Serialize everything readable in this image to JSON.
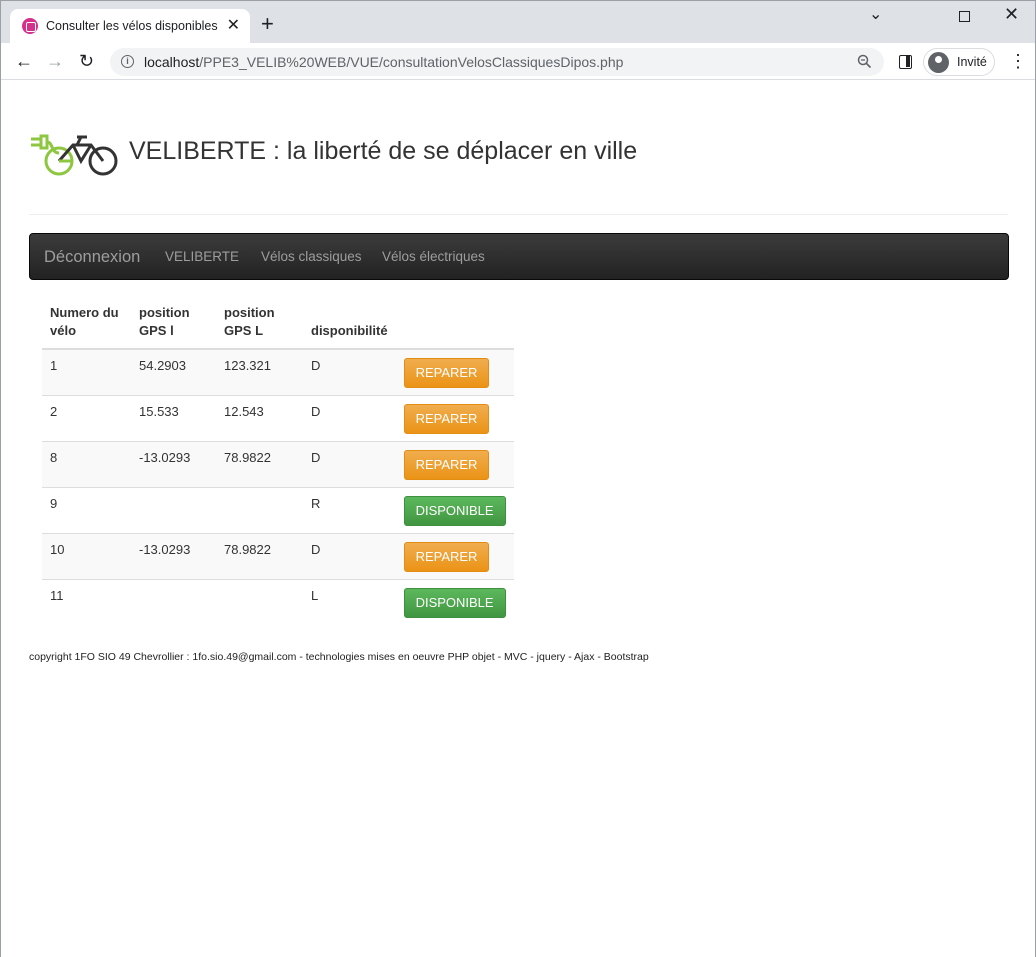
{
  "browser": {
    "tab_title": "Consulter les vélos disponibles...",
    "tab_close": "✕",
    "new_tab": "+",
    "url_host": "localhost",
    "url_path": "/PPE3_VELIB%20WEB/VUE/consultationVelosClassiquesDipos.php",
    "profile_label": "Invité"
  },
  "header": {
    "title": "VELIBERTE : la liberté de se déplacer en ville"
  },
  "navbar": {
    "brand": "Déconnexion",
    "links": [
      "VELIBERTE",
      "Vélos classiques",
      "Vélos électriques"
    ]
  },
  "table": {
    "headers": [
      "Numero du vélo",
      "position GPS l",
      "position GPS L",
      "disponibilité",
      ""
    ],
    "rows": [
      {
        "num": "1",
        "lat": "54.2903",
        "lng": "123.321",
        "dispo": "D",
        "action": "REPARER",
        "kind": "warning"
      },
      {
        "num": "2",
        "lat": "15.533",
        "lng": "12.543",
        "dispo": "D",
        "action": "REPARER",
        "kind": "warning"
      },
      {
        "num": "8",
        "lat": "-13.0293",
        "lng": "78.9822",
        "dispo": "D",
        "action": "REPARER",
        "kind": "warning"
      },
      {
        "num": "9",
        "lat": "",
        "lng": "",
        "dispo": "R",
        "action": "DISPONIBLE",
        "kind": "success"
      },
      {
        "num": "10",
        "lat": "-13.0293",
        "lng": "78.9822",
        "dispo": "D",
        "action": "REPARER",
        "kind": "warning"
      },
      {
        "num": "11",
        "lat": "",
        "lng": "",
        "dispo": "L",
        "action": "DISPONIBLE",
        "kind": "success"
      }
    ]
  },
  "footer": {
    "text": "copyright 1FO SIO 49 Chevrollier : 1fo.sio.49@gmail.com - technologies mises en oeuvre PHP objet - MVC - jquery - Ajax - Bootstrap"
  },
  "colors": {
    "warning": "#f0ad4e",
    "success": "#5cb85c",
    "navbar": "#222222",
    "logo_green": "#8dc63f"
  }
}
